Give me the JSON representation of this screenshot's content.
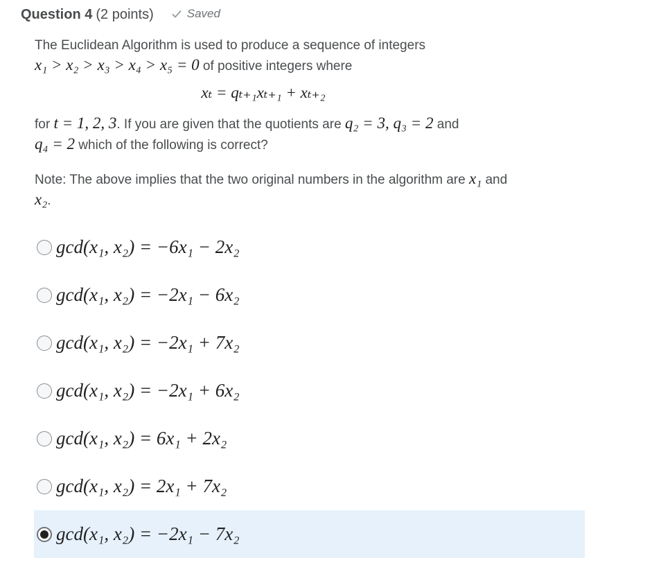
{
  "header": {
    "question_title": "Question 4",
    "points": "(2 points)",
    "saved_label": "Saved",
    "saved_icon": "checkmark-icon"
  },
  "stem": {
    "line1_text": "The Euclidean Algorithm is used to produce a sequence of integers",
    "line2_math": "x₁ > x₂ > x₃ > x₄ > x₅ = 0",
    "line2_text": " of positive integers where",
    "display_equation": "xₜ = qₜ₊₁xₜ₊₁ + xₜ₊₂",
    "para2_prefix": "for ",
    "para2_math1": "t = 1, 2, 3",
    "para2_text1": ". If you are given that the quotients are ",
    "para2_math2": "q₂ = 3, q₃ = 2",
    "para2_text2": " and",
    "para2_math3": "q₄ = 2",
    "para2_text3": " which of the following is correct?",
    "note_text": "Note: The above implies that the two original numbers in the algorithm are ",
    "note_math1": "x₁",
    "note_and": " and",
    "note_math2": "x₂",
    "note_end": "."
  },
  "options": [
    {
      "label": "gcd(x₁, x₂) = −6x₁ − 2x₂",
      "selected": false
    },
    {
      "label": "gcd(x₁, x₂) = −2x₁ − 6x₂",
      "selected": false
    },
    {
      "label": "gcd(x₁, x₂) = −2x₁ + 7x₂",
      "selected": false
    },
    {
      "label": "gcd(x₁, x₂) = −2x₁ + 6x₂",
      "selected": false
    },
    {
      "label": "gcd(x₁, x₂) = 6x₁ + 2x₂",
      "selected": false
    },
    {
      "label": "gcd(x₁, x₂) = 2x₁ + 7x₂",
      "selected": false
    },
    {
      "label": "gcd(x₁, x₂) = −2x₁ − 7x₂",
      "selected": true
    }
  ],
  "colors": {
    "text": "#494c4e",
    "math": "#202122",
    "selected_bg": "#e6f1fb",
    "saved_gray": "#6e7376"
  }
}
